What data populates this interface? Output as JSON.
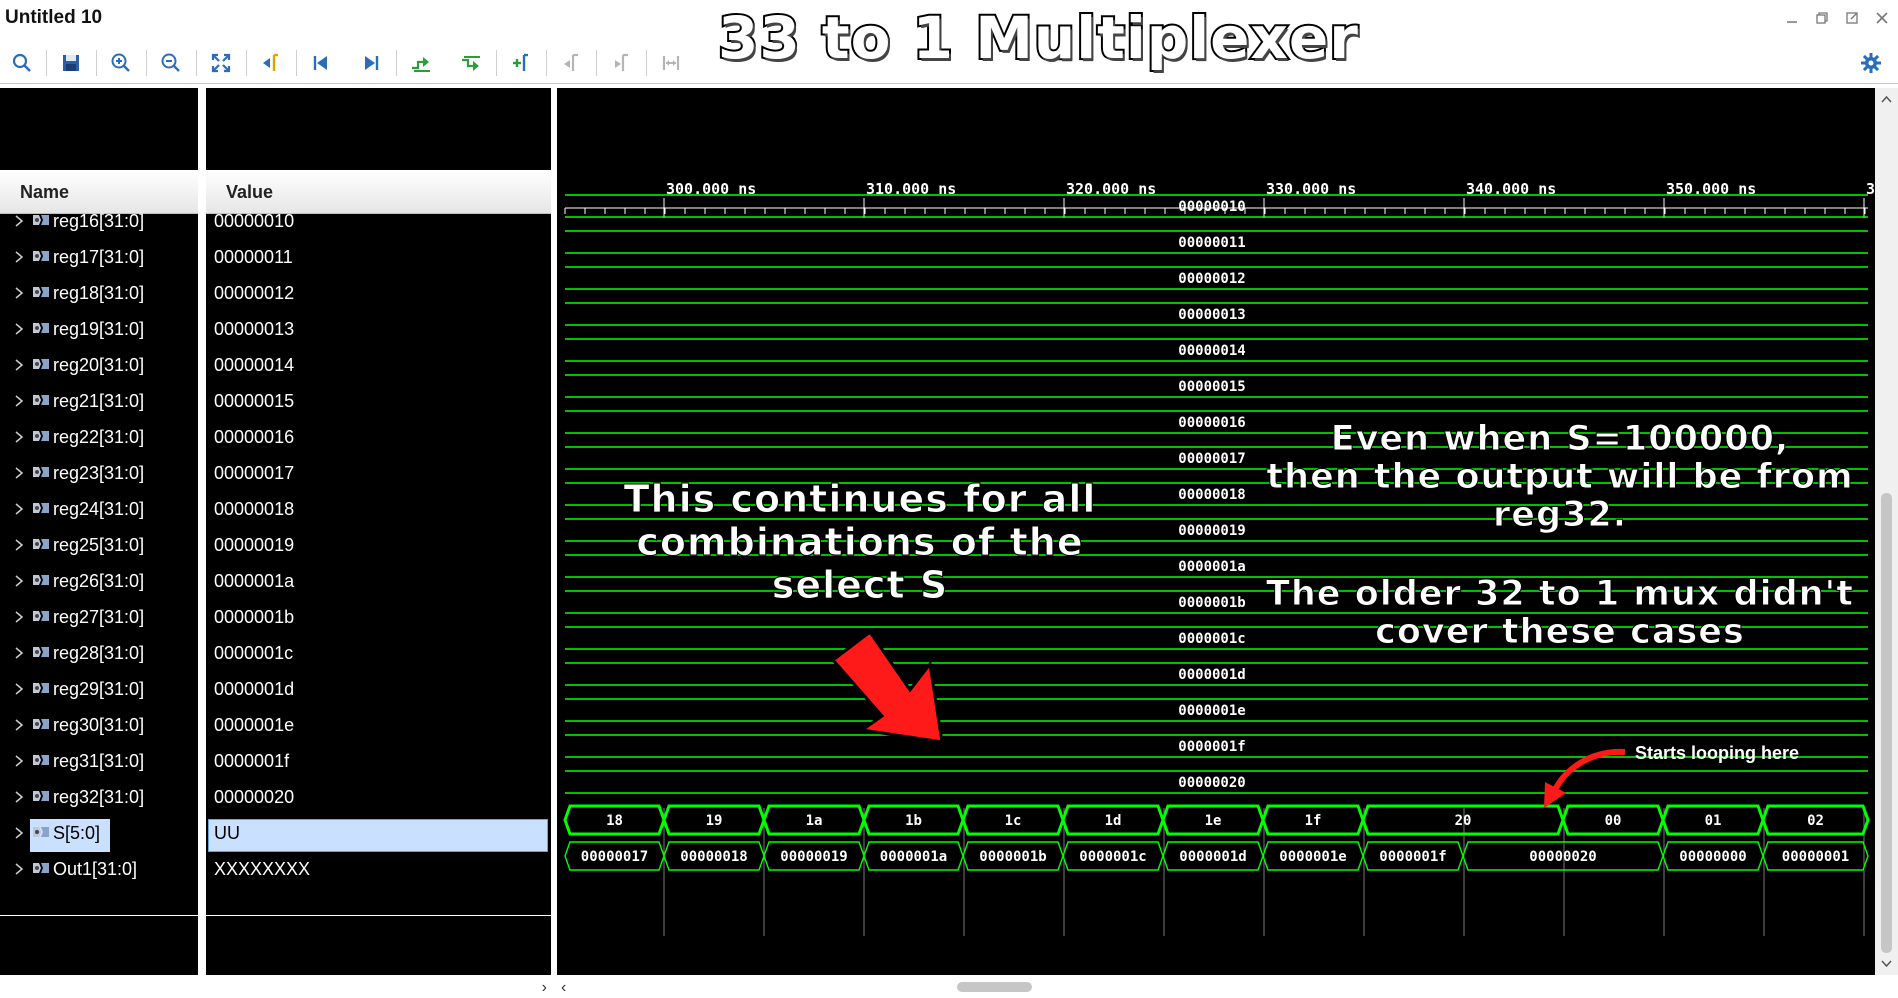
{
  "window": {
    "title": "Untitled 10",
    "minimize_icon": "minimize-icon",
    "restore_icon": "restore-icon",
    "undock_icon": "undock-icon",
    "close_icon": "close-icon"
  },
  "overlay_title": "33 to 1 Multiplexer",
  "toolbar": {
    "buttons": [
      {
        "name": "search-icon"
      },
      {
        "name": "save-icon"
      },
      {
        "name": "zoom-in-icon"
      },
      {
        "name": "zoom-out-icon"
      },
      {
        "name": "zoom-fit-icon"
      },
      {
        "name": "go-to-cursor-icon"
      },
      {
        "name": "go-to-time-zero-icon"
      },
      {
        "name": "go-to-last-time-icon"
      },
      {
        "name": "previous-transition-icon"
      },
      {
        "name": "next-transition-icon"
      },
      {
        "name": "add-marker-icon"
      },
      {
        "name": "previous-marker-icon"
      },
      {
        "name": "next-marker-icon"
      },
      {
        "name": "swap-cursors-icon"
      }
    ],
    "settings_icon": "gear-icon"
  },
  "columns": {
    "name": "Name",
    "value": "Value"
  },
  "signals": [
    {
      "name": "reg16[31:0]",
      "value": "00000010"
    },
    {
      "name": "reg17[31:0]",
      "value": "00000011"
    },
    {
      "name": "reg18[31:0]",
      "value": "00000012"
    },
    {
      "name": "reg19[31:0]",
      "value": "00000013"
    },
    {
      "name": "reg20[31:0]",
      "value": "00000014"
    },
    {
      "name": "reg21[31:0]",
      "value": "00000015"
    },
    {
      "name": "reg22[31:0]",
      "value": "00000016"
    },
    {
      "name": "reg23[31:0]",
      "value": "00000017"
    },
    {
      "name": "reg24[31:0]",
      "value": "00000018"
    },
    {
      "name": "reg25[31:0]",
      "value": "00000019"
    },
    {
      "name": "reg26[31:0]",
      "value": "0000001a"
    },
    {
      "name": "reg27[31:0]",
      "value": "0000001b"
    },
    {
      "name": "reg28[31:0]",
      "value": "0000001c"
    },
    {
      "name": "reg29[31:0]",
      "value": "0000001d"
    },
    {
      "name": "reg30[31:0]",
      "value": "0000001e"
    },
    {
      "name": "reg31[31:0]",
      "value": "0000001f"
    },
    {
      "name": "reg32[31:0]",
      "value": "00000020"
    },
    {
      "name": "S[5:0]",
      "value": "UU",
      "selected": true
    },
    {
      "name": "Out1[31:0]",
      "value": "XXXXXXXX"
    }
  ],
  "timeline": {
    "ticks": [
      "300.000 ns",
      "310.000 ns",
      "320.000 ns",
      "330.000 ns",
      "340.000 ns",
      "350.000 ns",
      "3"
    ]
  },
  "waveforms": {
    "constant_values": [
      "00000010",
      "00000011",
      "00000012",
      "00000013",
      "00000014",
      "00000015",
      "00000016",
      "00000017",
      "00000018",
      "00000019",
      "0000001a",
      "0000001b",
      "0000001c",
      "0000001d",
      "0000001e",
      "0000001f",
      "00000020"
    ],
    "s_segments": [
      "18",
      "19",
      "1a",
      "1b",
      "1c",
      "1d",
      "1e",
      "1f",
      "20",
      "00",
      "01",
      "02"
    ],
    "out_segments": [
      "00000017",
      "00000018",
      "00000019",
      "0000001a",
      "0000001b",
      "0000001c",
      "0000001d",
      "0000001e",
      "0000001f",
      "00000020",
      "00000000",
      "00000001"
    ]
  },
  "annotations": {
    "left_note": [
      "This continues for all",
      "combinations of the",
      "select S"
    ],
    "right_note_1": [
      "Even when S=100000,",
      "then the output will be from",
      "reg32."
    ],
    "right_note_2": [
      "The older 32 to 1 mux didn't",
      "cover these cases"
    ],
    "loop_note": "Starts looping here"
  },
  "colors": {
    "wave": "#00ff00",
    "background": "#000000",
    "arrow": "#ff1a1a"
  }
}
